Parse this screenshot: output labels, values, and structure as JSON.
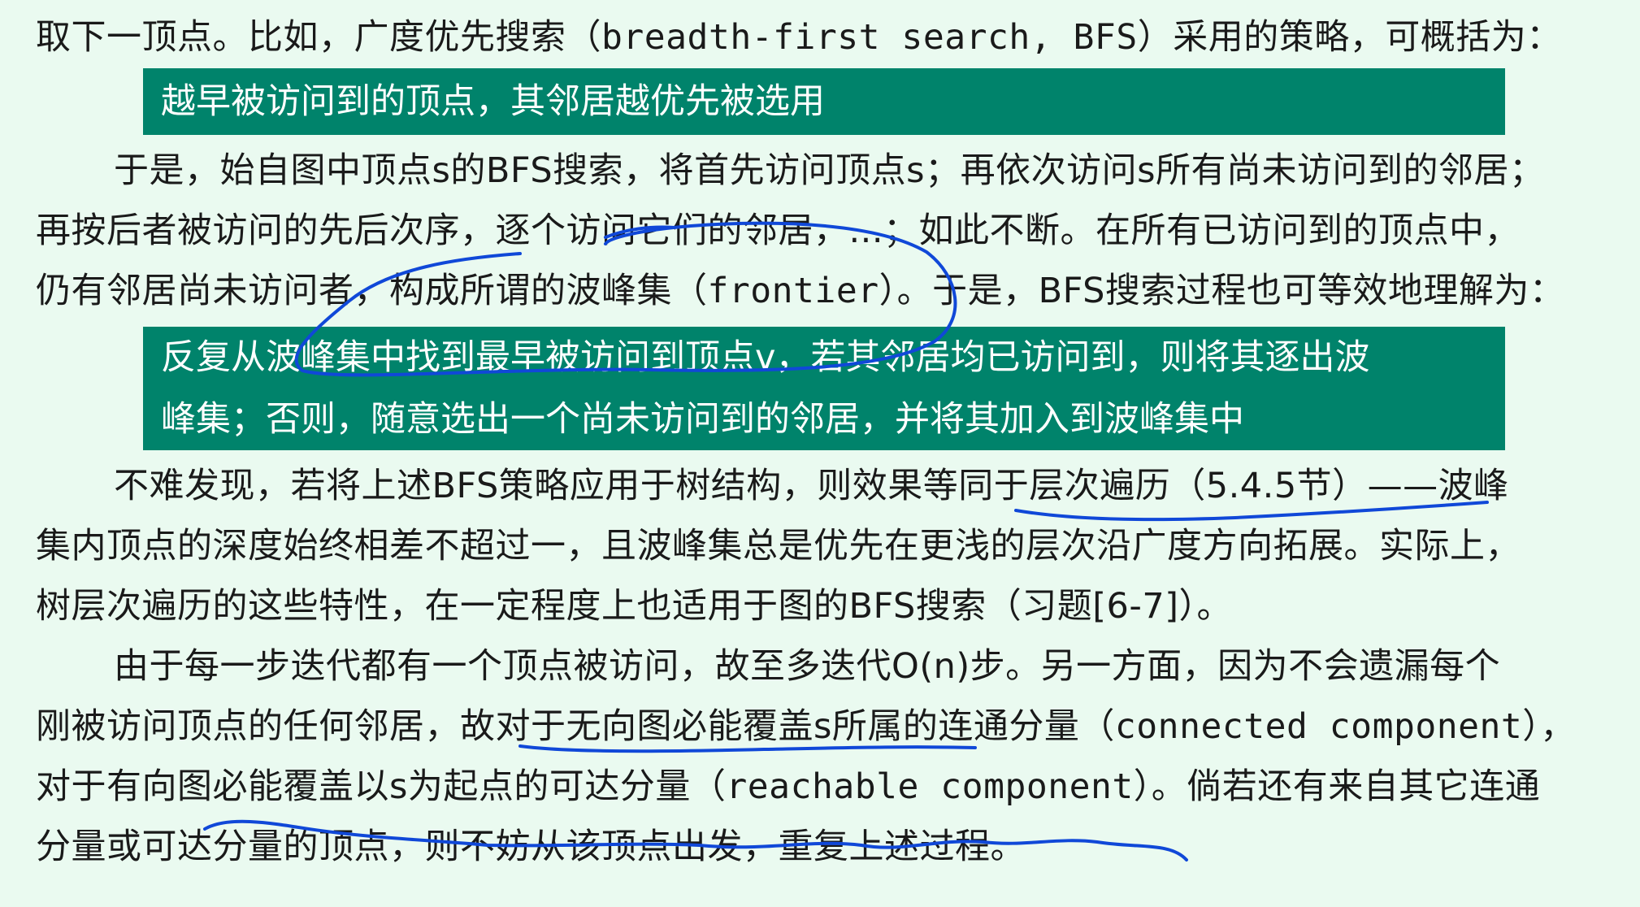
{
  "lines": {
    "l1": {
      "a": "取下一顶点。比如，广度优先搜索（",
      "code": "breadth-first search, BFS",
      "b": "）采用的策略，可概括为："
    },
    "l2": "于是，始自图中顶点s的BFS搜索，将首先访问顶点s；再依次访问s所有尚未访问到的邻居；",
    "l3": "再按后者被访问的先后次序，逐个访问它们的邻居，...；如此不断。在所有已访问到的顶点中，",
    "l4": {
      "a": "仍有邻居尚未访问者，构成所谓的波峰集（",
      "code": "frontier",
      "b": "）。于是，BFS搜索过程也可等效地理解为："
    },
    "l5": "不难发现，若将上述BFS策略应用于树结构，则效果等同于层次遍历（5.4.5节）——波峰",
    "l6": "集内顶点的深度始终相差不超过一，且波峰集总是优先在更浅的层次沿广度方向拓展。实际上，",
    "l7": "树层次遍历的这些特性，在一定程度上也适用于图的BFS搜索（习题[6-7]）。",
    "l8": "由于每一步迭代都有一个顶点被访问，故至多迭代O(n)步。另一方面，因为不会遗漏每个",
    "l9": {
      "a": "刚被访问顶点的任何邻居，故对于无向图必能覆盖s所属的连通分量（",
      "code": "connected component",
      "b": "），"
    },
    "l10": {
      "a": "对于有向图必能覆盖以s为起点的可达分量（",
      "code": "reachable component",
      "b": "）。倘若还有来自其它连通"
    },
    "l11": "分量或可达分量的顶点，则不妨从该顶点出发，重复上述过程。"
  },
  "callouts": {
    "c1": "越早被访问到的顶点，其邻居越优先被选用",
    "c2_line1": "反复从波峰集中找到最早被访问到顶点v，若其邻居均已访问到，则将其逐出波",
    "c2_line2": "峰集；否则，随意选出一个尚未访问到的邻居，并将其加入到波峰集中"
  },
  "colors": {
    "background": "#eafaf0",
    "callout": "#00836b",
    "ink": "#1048d8"
  }
}
